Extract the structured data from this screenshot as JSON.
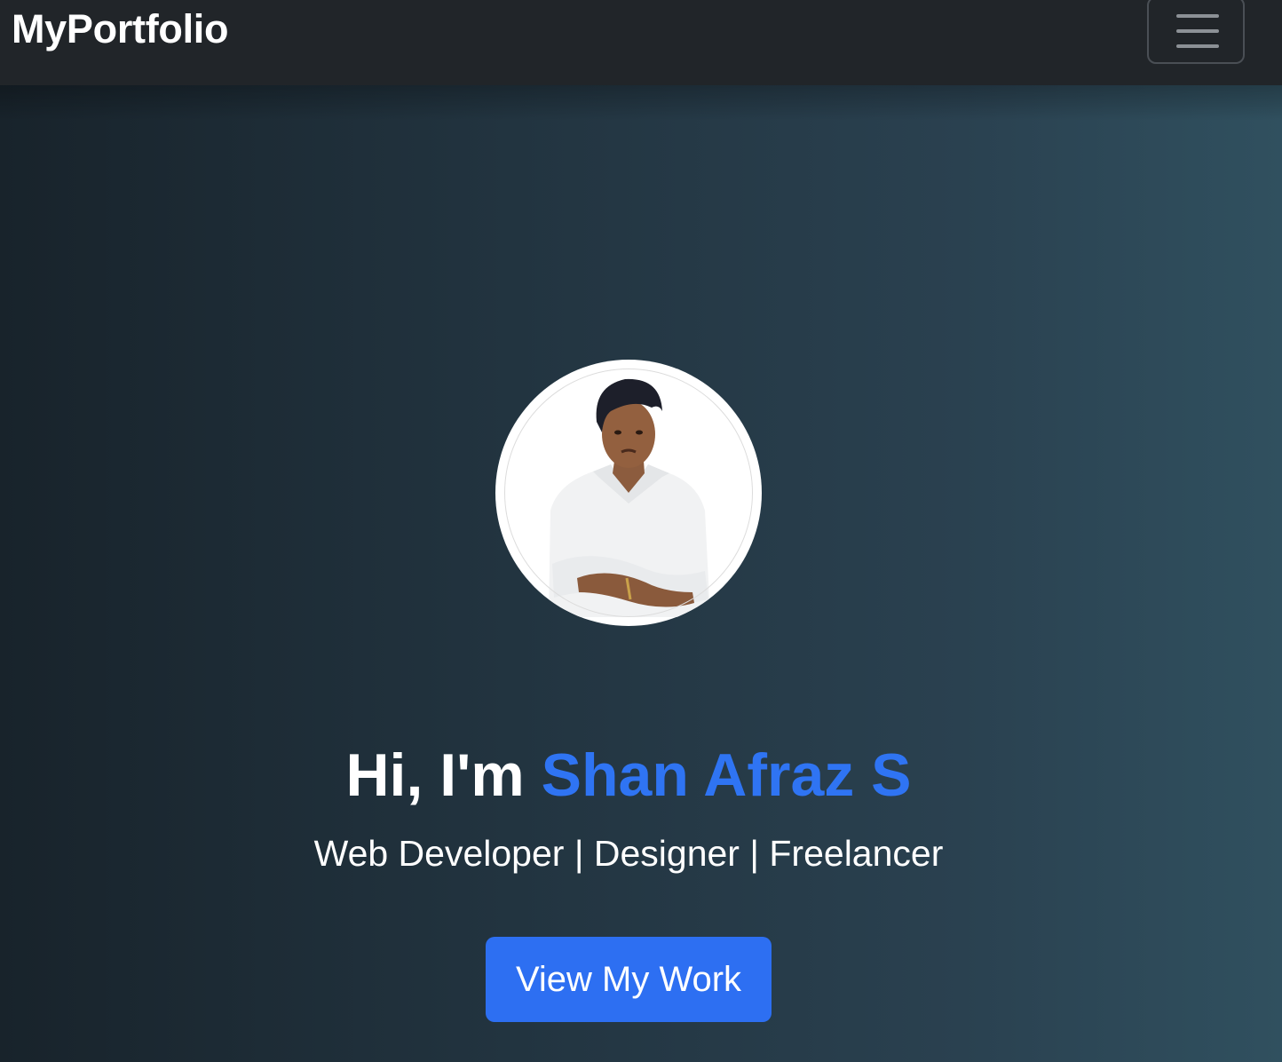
{
  "navbar": {
    "brand": "MyPortfolio",
    "toggle_icon": "hamburger-menu-icon",
    "background": "#212529"
  },
  "hero": {
    "greeting": "Hi, I'm ",
    "name": "Shan Afraz S",
    "tagline": "Web Developer | Designer | Freelancer",
    "cta_label": "View My Work",
    "accent_color": "#2f74f3",
    "profile_image": "profile-photo"
  }
}
